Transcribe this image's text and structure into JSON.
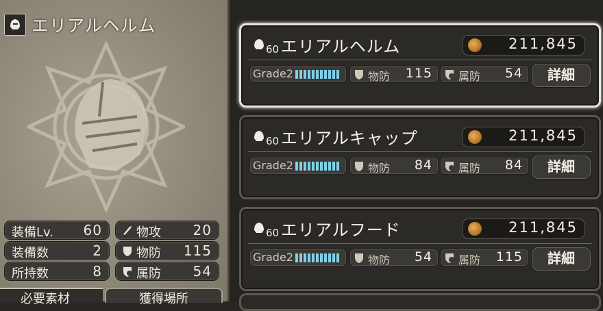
{
  "selected_item": {
    "title": "エリアルヘルム",
    "icon": "helmet-icon"
  },
  "stats": [
    {
      "label": "装備Lv.",
      "value": "60"
    },
    {
      "label": "装備数",
      "value": "2"
    },
    {
      "label": "所持数",
      "value": "8"
    }
  ],
  "attributes": [
    {
      "label": "物攻",
      "value": "20",
      "icon": "attack-icon"
    },
    {
      "label": "物防",
      "value": "115",
      "icon": "physical-defense-icon"
    },
    {
      "label": "属防",
      "value": "54",
      "icon": "elemental-defense-icon"
    }
  ],
  "bottom": {
    "materials_label": "必要素材",
    "acquire_label": "獲得場所"
  },
  "items": [
    {
      "level": "60",
      "name": "エリアルヘルム",
      "price": "211,845",
      "grade": "Grade2",
      "grade_fill": 1.0,
      "phys_label": "物防",
      "phys_value": "115",
      "elem_label": "属防",
      "elem_value": "54",
      "detail_label": "詳細"
    },
    {
      "level": "60",
      "name": "エリアルキャップ",
      "price": "211,845",
      "grade": "Grade2",
      "grade_fill": 1.0,
      "phys_label": "物防",
      "phys_value": "84",
      "elem_label": "属防",
      "elem_value": "84",
      "detail_label": "詳細"
    },
    {
      "level": "60",
      "name": "エリアルフード",
      "price": "211,845",
      "grade": "Grade2",
      "grade_fill": 1.0,
      "phys_label": "物防",
      "phys_value": "54",
      "elem_label": "属防",
      "elem_value": "115",
      "detail_label": "詳細"
    }
  ],
  "colors": {
    "grade_bar": "#7fd0e8",
    "coin": "#c98a34",
    "panel_bg": "#2c2a27",
    "selected_border": "#e8e4dc"
  }
}
